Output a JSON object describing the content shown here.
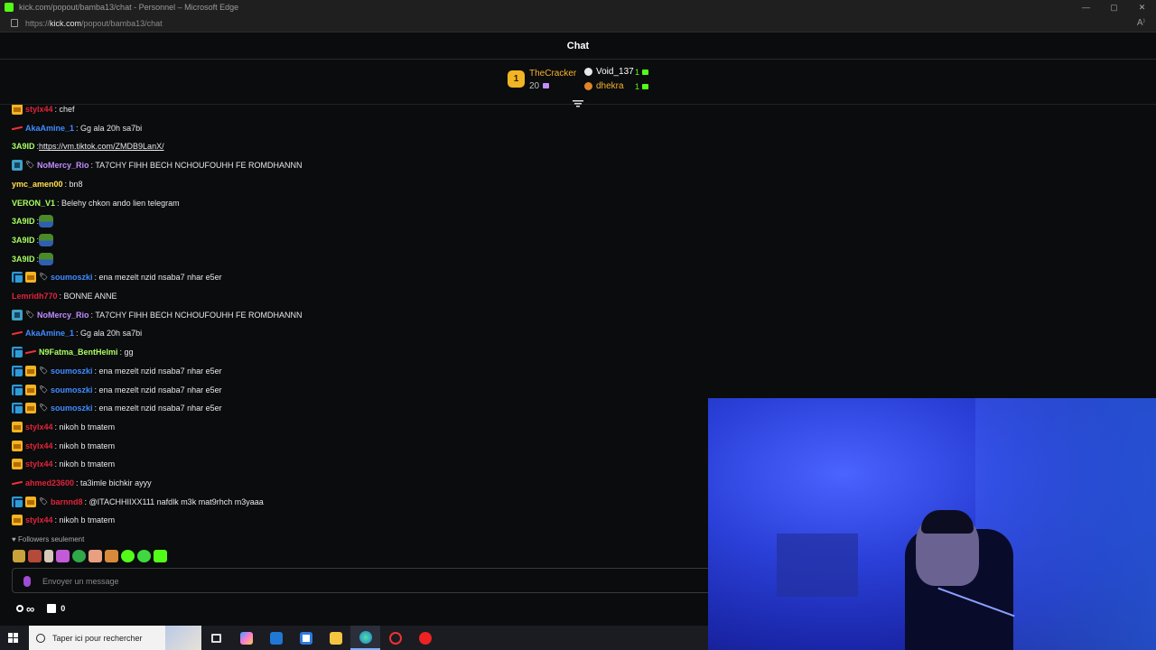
{
  "browser": {
    "window_title": "kick.com/popout/bamba13/chat - Personnel – Microsoft Edge",
    "url_prefix": "https://",
    "url_domain": "kick.com",
    "url_path": "/popout/bamba13/chat",
    "accent": "#53fc18"
  },
  "chat": {
    "title": "Chat",
    "leaderboard": {
      "first": {
        "rank": "1",
        "name": "TheCracker",
        "count": "20"
      },
      "second": {
        "name": "Void_137",
        "count": "1"
      },
      "third": {
        "name": "dhekra",
        "count": "1"
      }
    },
    "messages": [
      {
        "badges": [
          "crown"
        ],
        "user": "stylx44",
        "color": "#e0243a",
        "text": ": chef"
      },
      {
        "badges": [
          "sword"
        ],
        "user": "AkaAmine_1",
        "color": "#3f8cff",
        "text": ": Gg ala 20h sa7bi"
      },
      {
        "badges": [],
        "user": "3A9ID",
        "color": "#a8ff60",
        "text": ": ",
        "link": "https://vm.tiktok.com/ZMDB9LanX/"
      },
      {
        "badges": [
          "sub",
          "tag"
        ],
        "user": "NoMercy_Rio",
        "color": "#c08cff",
        "text": ": TA7CHY FIHH BECH NCHOUFOUHH FE ROMDHANNN"
      },
      {
        "badges": [],
        "user": "ymc_amen00",
        "color": "#ffe14d",
        "text": ": bn8"
      },
      {
        "badges": [],
        "user": "VERON_V1",
        "color": "#a8ff60",
        "text": ": Belehy chkon ando lien telegram"
      },
      {
        "badges": [],
        "user": "3A9ID",
        "color": "#a8ff60",
        "text": ": ",
        "emote": true
      },
      {
        "badges": [],
        "user": "3A9ID",
        "color": "#a8ff60",
        "text": ": ",
        "emote": true
      },
      {
        "badges": [],
        "user": "3A9ID",
        "color": "#a8ff60",
        "text": ": ",
        "emote": true
      },
      {
        "badges": [
          "vip",
          "crown",
          "tag"
        ],
        "user": "soumoszki",
        "color": "#3f8cff",
        "text": ": ena mezelt nzid nsaba7 nhar e5er"
      },
      {
        "badges": [],
        "user": "Lemridh770",
        "color": "#e0243a",
        "text": ": BONNE ANNE"
      },
      {
        "badges": [
          "sub",
          "tag"
        ],
        "user": "NoMercy_Rio",
        "color": "#c08cff",
        "text": ": TA7CHY FIHH BECH NCHOUFOUHH FE ROMDHANNN"
      },
      {
        "badges": [
          "sword"
        ],
        "user": "AkaAmine_1",
        "color": "#3f8cff",
        "text": ": Gg ala 20h sa7bi"
      },
      {
        "badges": [
          "vip",
          "sword"
        ],
        "user": "N9Fatma_BentHelmi",
        "color": "#a8ff60",
        "text": ": gg"
      },
      {
        "badges": [
          "vip",
          "crown",
          "tag"
        ],
        "user": "soumoszki",
        "color": "#3f8cff",
        "text": ": ena mezelt nzid nsaba7 nhar e5er"
      },
      {
        "badges": [
          "vip",
          "crown",
          "tag"
        ],
        "user": "soumoszki",
        "color": "#3f8cff",
        "text": ": ena mezelt nzid nsaba7 nhar e5er"
      },
      {
        "badges": [
          "vip",
          "crown",
          "tag"
        ],
        "user": "soumoszki",
        "color": "#3f8cff",
        "text": ": ena mezelt nzid nsaba7 nhar e5er"
      },
      {
        "badges": [
          "crown"
        ],
        "user": "stylx44",
        "color": "#e0243a",
        "text": ": nikoh b tmatem"
      },
      {
        "badges": [
          "crown"
        ],
        "user": "stylx44",
        "color": "#e0243a",
        "text": ": nikoh b tmatem"
      },
      {
        "badges": [
          "crown"
        ],
        "user": "stylx44",
        "color": "#e0243a",
        "text": ": nikoh b tmatem"
      },
      {
        "badges": [
          "sword"
        ],
        "user": "ahmed23600",
        "color": "#e0243a",
        "text": ": ta3imle bichkir ayyy"
      },
      {
        "badges": [
          "vip",
          "crown",
          "tag"
        ],
        "user": "barnnd8",
        "color": "#e0243a",
        "text": ": @ITACHHIIXX111 nafdlk m3k mat9rhch m3yaaa"
      },
      {
        "badges": [
          "crown"
        ],
        "user": "stylx44",
        "color": "#e0243a",
        "text": ": nikoh b tmatem"
      }
    ],
    "followers_only": "Followers seulement",
    "input_placeholder": "Envoyer un message",
    "footer": {
      "infinity": "∞",
      "count": "0"
    }
  },
  "taskbar": {
    "search_placeholder": "Taper ici pour rechercher"
  }
}
